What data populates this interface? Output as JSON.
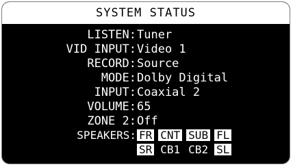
{
  "title": "SYSTEM STATUS",
  "status_rows": [
    {
      "label": "LISTEN:",
      "value": "Tuner"
    },
    {
      "label": "VID INPUT:",
      "value": "Video 1"
    },
    {
      "label": "RECORD:",
      "value": "Source"
    },
    {
      "label": "MODE:",
      "value": "Dolby Digital"
    },
    {
      "label": "INPUT:",
      "value": "Coaxial 2"
    },
    {
      "label": "VOLUME:",
      "value": "65"
    },
    {
      "label": "ZONE 2:",
      "value": "Off"
    }
  ],
  "speakers": {
    "label": "SPEAKERS:",
    "row1": [
      {
        "name": "FR",
        "active": true
      },
      {
        "name": "CNT",
        "active": true
      },
      {
        "name": "SUB",
        "active": true
      },
      {
        "name": "FL",
        "active": true
      }
    ],
    "row2": [
      {
        "name": "SR",
        "active": true
      },
      {
        "name": "CB1",
        "active": false
      },
      {
        "name": "CB2",
        "active": false
      },
      {
        "name": "SL",
        "active": true
      }
    ]
  },
  "colors": {
    "background": "#000000",
    "text": "#ffffff",
    "highlight": "#ffffff"
  }
}
